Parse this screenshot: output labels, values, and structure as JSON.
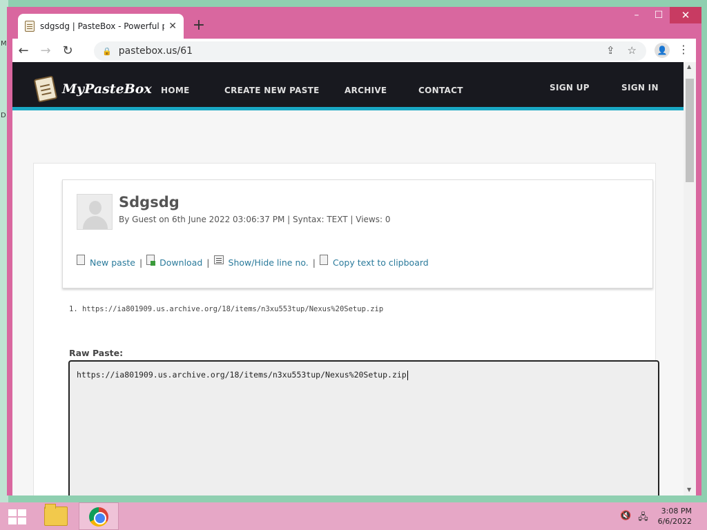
{
  "desktop": {
    "glyph_top": "M",
    "glyph_mid": "D"
  },
  "window": {
    "minimize": "–",
    "maximize": "☐",
    "close": "✕"
  },
  "tab": {
    "title": "sdgsdg | PasteBox - Powerful pas",
    "close": "✕",
    "new_tab": "+"
  },
  "toolbar": {
    "back": "←",
    "forward": "→",
    "reload": "↻",
    "lock": "🔒",
    "url": "pastebox.us/61",
    "share": "⇪",
    "bookmark": "☆",
    "profile": "👤",
    "menu": "⋮"
  },
  "site": {
    "logo": "MyPasteBox",
    "nav": [
      "HOME",
      "CREATE NEW PASTE",
      "ARCHIVE",
      "CONTACT"
    ],
    "sign_up": "SIGN UP",
    "sign_in": "SIGN IN"
  },
  "paste": {
    "title": "Sdgsdg",
    "meta": "By Guest on 6th June 2022 03:06:37 PM | Syntax: TEXT | Views: 0",
    "actions": [
      "New paste",
      "Download",
      "Show/Hide line no.",
      "Copy text to clipboard"
    ],
    "separator": "|",
    "line_number": "1.",
    "line_text": "https://ia801909.us.archive.org/18/items/n3xu553tup/Nexus%20Setup.zip",
    "raw_label": "Raw Paste:",
    "raw_text": "https://ia801909.us.archive.org/18/items/n3xu553tup/Nexus%20Setup.zip"
  },
  "scroll": {
    "up": "▲",
    "down": "▼"
  },
  "taskbar": {
    "tray_volume": "🔇",
    "tray_network": "🖧",
    "time": "3:08 PM",
    "date": "6/6/2022"
  }
}
